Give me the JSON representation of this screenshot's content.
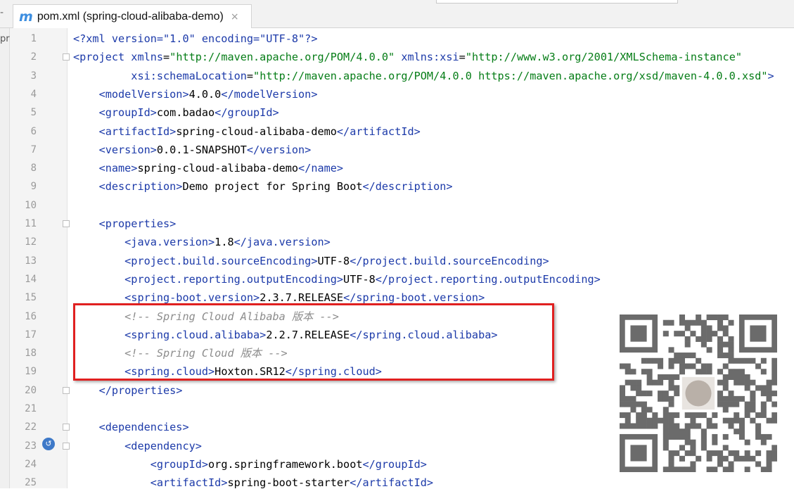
{
  "tab": {
    "title": "pom.xml (spring-cloud-alibaba-demo)",
    "file_icon_letter": "m",
    "close_glyph": "×"
  },
  "left_toggle_glyph": "-",
  "side_panel_label": "pr",
  "editor": {
    "lines": [
      {
        "n": "1",
        "segs": [
          [
            "pi",
            "<?xml version=\"1.0\" encoding=\"UTF-8\"?>"
          ]
        ]
      },
      {
        "n": "2",
        "segs": [
          [
            "tg",
            "<project "
          ],
          [
            "at",
            "xmlns"
          ],
          [
            "tx",
            "="
          ],
          [
            "av",
            "\"http://maven.apache.org/POM/4.0.0\""
          ],
          [
            "tx",
            " "
          ],
          [
            "at",
            "xmlns:xsi"
          ],
          [
            "tx",
            "="
          ],
          [
            "av",
            "\"http://www.w3.org/2001/XMLSchema-instance\""
          ]
        ]
      },
      {
        "n": "3",
        "segs": [
          [
            "tx",
            "         "
          ],
          [
            "at",
            "xsi:schemaLocation"
          ],
          [
            "tx",
            "="
          ],
          [
            "av",
            "\"http://maven.apache.org/POM/4.0.0 https://maven.apache.org/xsd/maven-4.0.0.xsd\""
          ],
          [
            "tg",
            ">"
          ]
        ]
      },
      {
        "n": "4",
        "segs": [
          [
            "tx",
            "    "
          ],
          [
            "tg",
            "<modelVersion>"
          ],
          [
            "tx",
            "4.0.0"
          ],
          [
            "tg",
            "</modelVersion>"
          ]
        ]
      },
      {
        "n": "5",
        "segs": [
          [
            "tx",
            "    "
          ],
          [
            "tg",
            "<groupId>"
          ],
          [
            "tx",
            "com.badao"
          ],
          [
            "tg",
            "</groupId>"
          ]
        ]
      },
      {
        "n": "6",
        "segs": [
          [
            "tx",
            "    "
          ],
          [
            "tg",
            "<artifactId>"
          ],
          [
            "tx",
            "spring-cloud-alibaba-demo"
          ],
          [
            "tg",
            "</artifactId>"
          ]
        ]
      },
      {
        "n": "7",
        "segs": [
          [
            "tx",
            "    "
          ],
          [
            "tg",
            "<version>"
          ],
          [
            "tx",
            "0.0.1-SNAPSHOT"
          ],
          [
            "tg",
            "</version>"
          ]
        ]
      },
      {
        "n": "8",
        "segs": [
          [
            "tx",
            "    "
          ],
          [
            "tg",
            "<name>"
          ],
          [
            "tx",
            "spring-cloud-alibaba-demo"
          ],
          [
            "tg",
            "</name>"
          ]
        ]
      },
      {
        "n": "9",
        "segs": [
          [
            "tx",
            "    "
          ],
          [
            "tg",
            "<description>"
          ],
          [
            "tx",
            "Demo project for Spring Boot"
          ],
          [
            "tg",
            "</description>"
          ]
        ]
      },
      {
        "n": "10",
        "segs": []
      },
      {
        "n": "11",
        "segs": [
          [
            "tx",
            "    "
          ],
          [
            "tg",
            "<properties>"
          ]
        ]
      },
      {
        "n": "12",
        "segs": [
          [
            "tx",
            "        "
          ],
          [
            "tg",
            "<java.version>"
          ],
          [
            "tx",
            "1.8"
          ],
          [
            "tg",
            "</java.version>"
          ]
        ]
      },
      {
        "n": "13",
        "segs": [
          [
            "tx",
            "        "
          ],
          [
            "tg",
            "<project.build.sourceEncoding>"
          ],
          [
            "tx",
            "UTF-8"
          ],
          [
            "tg",
            "</project.build.sourceEncoding>"
          ]
        ]
      },
      {
        "n": "14",
        "segs": [
          [
            "tx",
            "        "
          ],
          [
            "tg",
            "<project.reporting.outputEncoding>"
          ],
          [
            "tx",
            "UTF-8"
          ],
          [
            "tg",
            "</project.reporting.outputEncoding>"
          ]
        ]
      },
      {
        "n": "15",
        "segs": [
          [
            "tx",
            "        "
          ],
          [
            "tg",
            "<spring-boot.version>"
          ],
          [
            "tx",
            "2.3.7.RELEASE"
          ],
          [
            "tg",
            "</spring-boot.version>"
          ]
        ]
      },
      {
        "n": "16",
        "segs": [
          [
            "tx",
            "        "
          ],
          [
            "cm",
            "<!-- Spring Cloud Alibaba 版本 -->"
          ]
        ]
      },
      {
        "n": "17",
        "segs": [
          [
            "tx",
            "        "
          ],
          [
            "tg",
            "<spring.cloud.alibaba>"
          ],
          [
            "tx",
            "2.2.7.RELEASE"
          ],
          [
            "tg",
            "</spring.cloud.alibaba>"
          ]
        ]
      },
      {
        "n": "18",
        "segs": [
          [
            "tx",
            "        "
          ],
          [
            "cm",
            "<!-- Spring Cloud 版本 -->"
          ]
        ]
      },
      {
        "n": "19",
        "segs": [
          [
            "tx",
            "        "
          ],
          [
            "tg",
            "<spring.cloud>"
          ],
          [
            "tx",
            "Hoxton.SR12"
          ],
          [
            "tg",
            "</spring.cloud>"
          ]
        ]
      },
      {
        "n": "20",
        "segs": [
          [
            "tx",
            "    "
          ],
          [
            "tg",
            "</properties>"
          ]
        ]
      },
      {
        "n": "21",
        "segs": []
      },
      {
        "n": "22",
        "segs": [
          [
            "tx",
            "    "
          ],
          [
            "tg",
            "<dependencies>"
          ]
        ]
      },
      {
        "n": "23",
        "segs": [
          [
            "tx",
            "        "
          ],
          [
            "tg",
            "<dependency>"
          ]
        ]
      },
      {
        "n": "24",
        "segs": [
          [
            "tx",
            "            "
          ],
          [
            "tg",
            "<groupId>"
          ],
          [
            "tx",
            "org.springframework.boot"
          ],
          [
            "tg",
            "</groupId>"
          ]
        ]
      },
      {
        "n": "25",
        "segs": [
          [
            "tx",
            "            "
          ],
          [
            "tg",
            "<artifactId>"
          ],
          [
            "tx",
            "spring-boot-starter"
          ],
          [
            "tg",
            "</artifactId>"
          ]
        ]
      }
    ]
  },
  "colors": {
    "tag": "#1c3aa9",
    "attr_value": "#067d17",
    "comment": "#8c8c8c",
    "highlight_border": "#e02020",
    "file_icon": "#3d8ee0"
  },
  "icons": {
    "run_gutter_icon": "maven-run-icon",
    "qr": "qr-code-icon"
  }
}
